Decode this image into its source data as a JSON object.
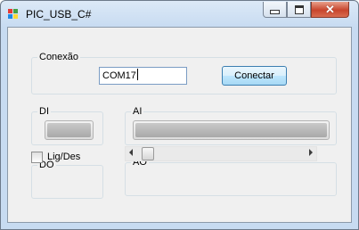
{
  "window": {
    "title": "PIC_USB_C#",
    "close_glyph": "✕",
    "icons": {
      "app": "app-icon",
      "minimize": "minimize-icon",
      "maximize": "maximize-icon",
      "close": "close-icon"
    }
  },
  "conexao": {
    "label": "Conexão",
    "port_value": "COM17",
    "connect_label": "Conectar"
  },
  "di": {
    "label": "DI",
    "level": 0.0
  },
  "ai": {
    "label": "AI",
    "level": 0.0
  },
  "do": {
    "label": "DO",
    "checkbox_label": "Lig/Des",
    "checked": false
  },
  "ao": {
    "label": "AO",
    "value_fraction": 0.0
  },
  "colors": {
    "button_border": "#3c7fb1",
    "close_button": "#c8452c"
  }
}
